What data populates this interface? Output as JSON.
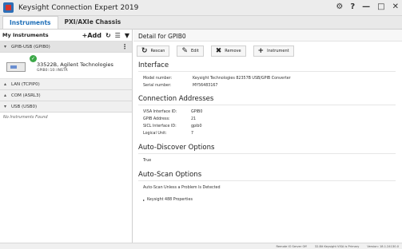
{
  "window": {
    "title": "Keysight Connection Expert 2019",
    "controls": [
      "⚙",
      "?",
      "—",
      "□",
      "✕"
    ]
  },
  "tabs": [
    {
      "label": "Instruments",
      "active": true
    },
    {
      "label": "PXI/AXIe Chassis",
      "active": false
    }
  ],
  "left": {
    "title": "My Instruments",
    "add_label": "Add",
    "groups": {
      "gpib": {
        "label": "GPIB-USB (GPIB0)"
      },
      "lan": {
        "label": "LAN (TCPIP0)"
      },
      "com": {
        "label": "COM (ASRL3)"
      },
      "usb": {
        "label": "USB (USB0)"
      }
    },
    "instrument": {
      "name": "33522B, Agilent Technologies",
      "address": "GPIB0::10::INSTR"
    },
    "none_found": "No Instruments Found"
  },
  "detail": {
    "header": "Detail for GPIB0",
    "toolbar": {
      "rescan": "Rescan",
      "edit": "Edit",
      "remove": "Remove",
      "instrument": "Instrument"
    },
    "interface": {
      "title": "Interface",
      "model_label": "Model number:",
      "model_value": "Keysight Technologies 82357B USB/GPIB Converter",
      "serial_label": "Serial number:",
      "serial_value": "MY56483167"
    },
    "connection": {
      "title": "Connection Addresses",
      "visa_label": "VISA Interface ID:",
      "visa_value": "GPIB0",
      "gpib_label": "GPIB Address:",
      "gpib_value": "21",
      "sicl_label": "SICL Interface ID:",
      "sicl_value": "gpib0",
      "logical_label": "Logical Unit:",
      "logical_value": "7"
    },
    "auto_discover": {
      "title": "Auto-Discover Options",
      "value": "True"
    },
    "auto_scan": {
      "title": "Auto-Scan Options",
      "value": "Auto-Scan Unless a Problem Is Detected"
    },
    "props": "Keysight 488 Properties"
  },
  "status": {
    "remote_io": "Remote IO Server Off",
    "visa": "32-Bit Keysight VISA is Primary",
    "version": "Version: 18.1.24130.0"
  }
}
